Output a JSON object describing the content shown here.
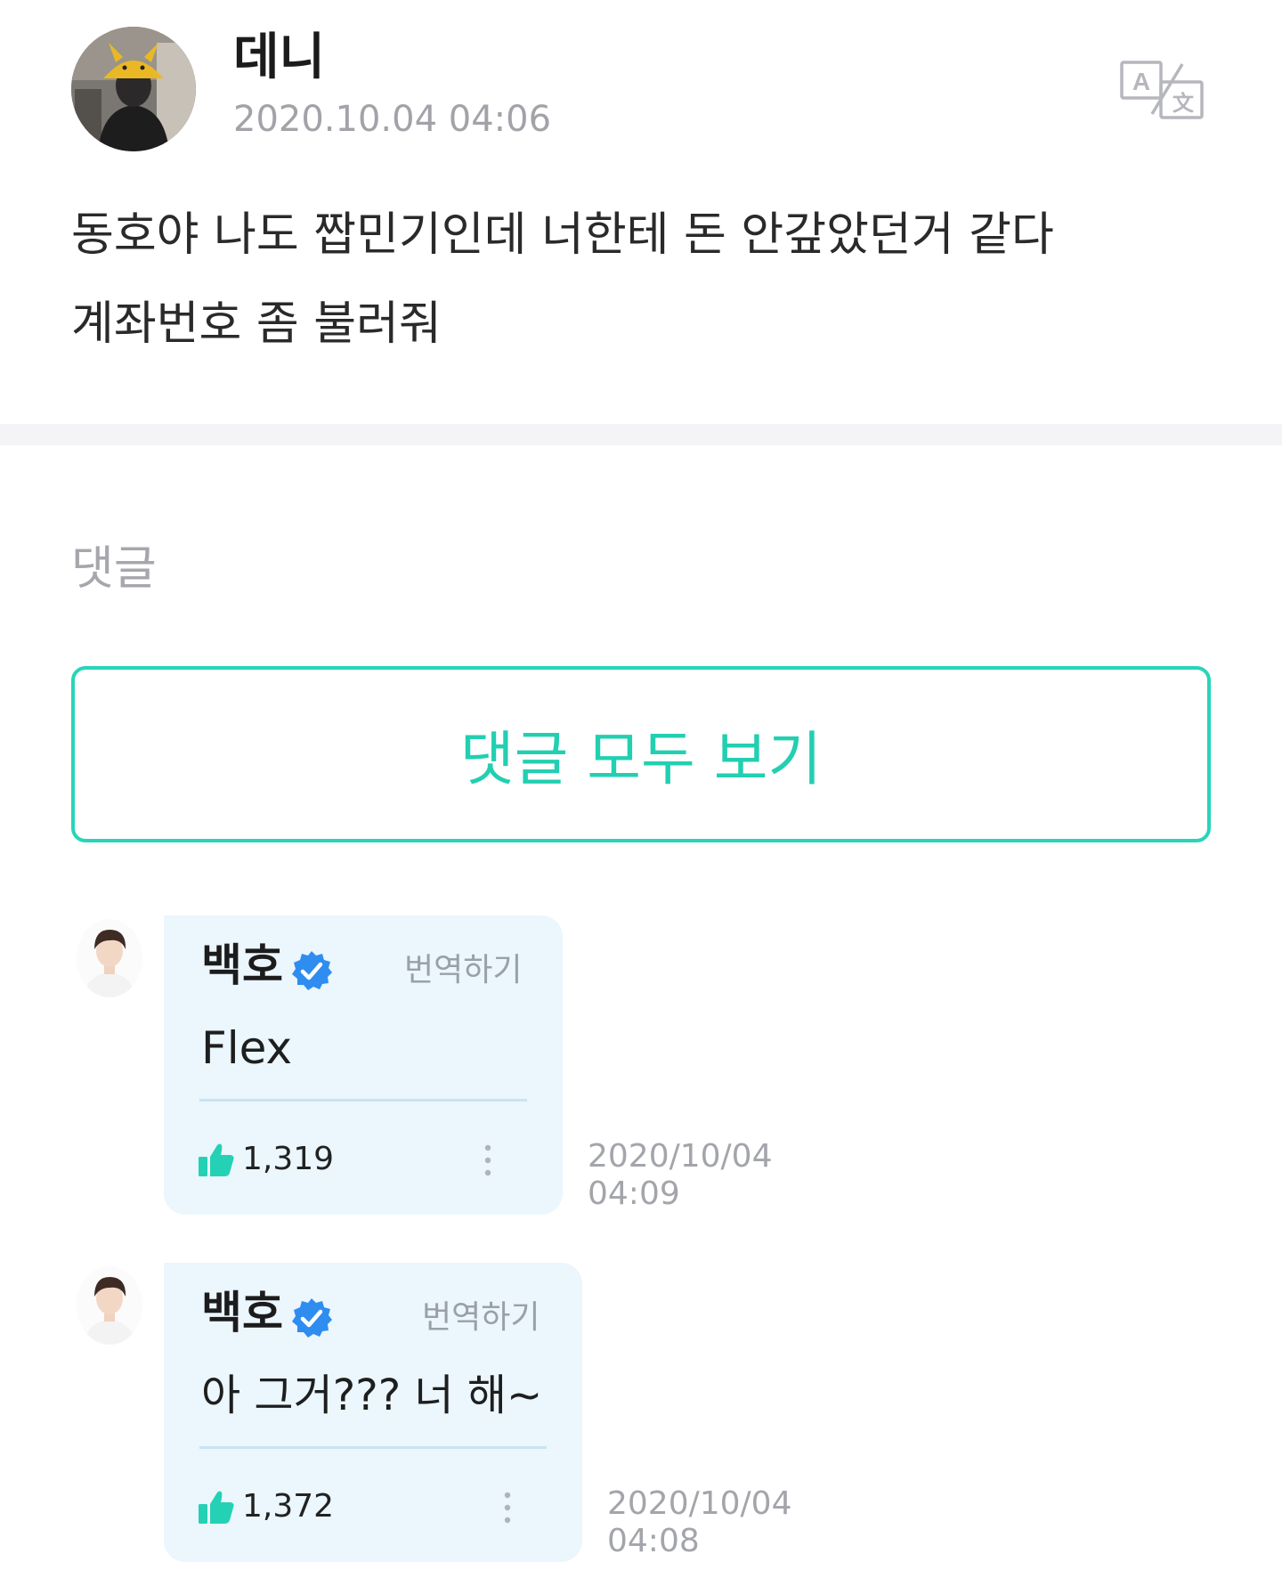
{
  "post": {
    "author": "데니",
    "timestamp": "2020.10.04 04:06",
    "body": "동호야 나도 짭민기인데 너한테 돈 안갚았던거 같다 계좌번호 좀 불러줘",
    "translate_icon": "translate-icon"
  },
  "comments_section": {
    "heading": "댓글",
    "view_all_label": "댓글 모두 보기",
    "accent_color": "#22cfb1"
  },
  "comments": [
    {
      "author": "백호",
      "verified_icon": "verified-badge-icon",
      "translate_label": "번역하기",
      "text": "Flex",
      "likes": "1,319",
      "date": "2020/10/04",
      "time": "04:09"
    },
    {
      "author": "백호",
      "verified_icon": "verified-badge-icon",
      "translate_label": "번역하기",
      "text": "아 그거??? 너 해~",
      "likes": "1,372",
      "date": "2020/10/04",
      "time": "04:08"
    }
  ]
}
